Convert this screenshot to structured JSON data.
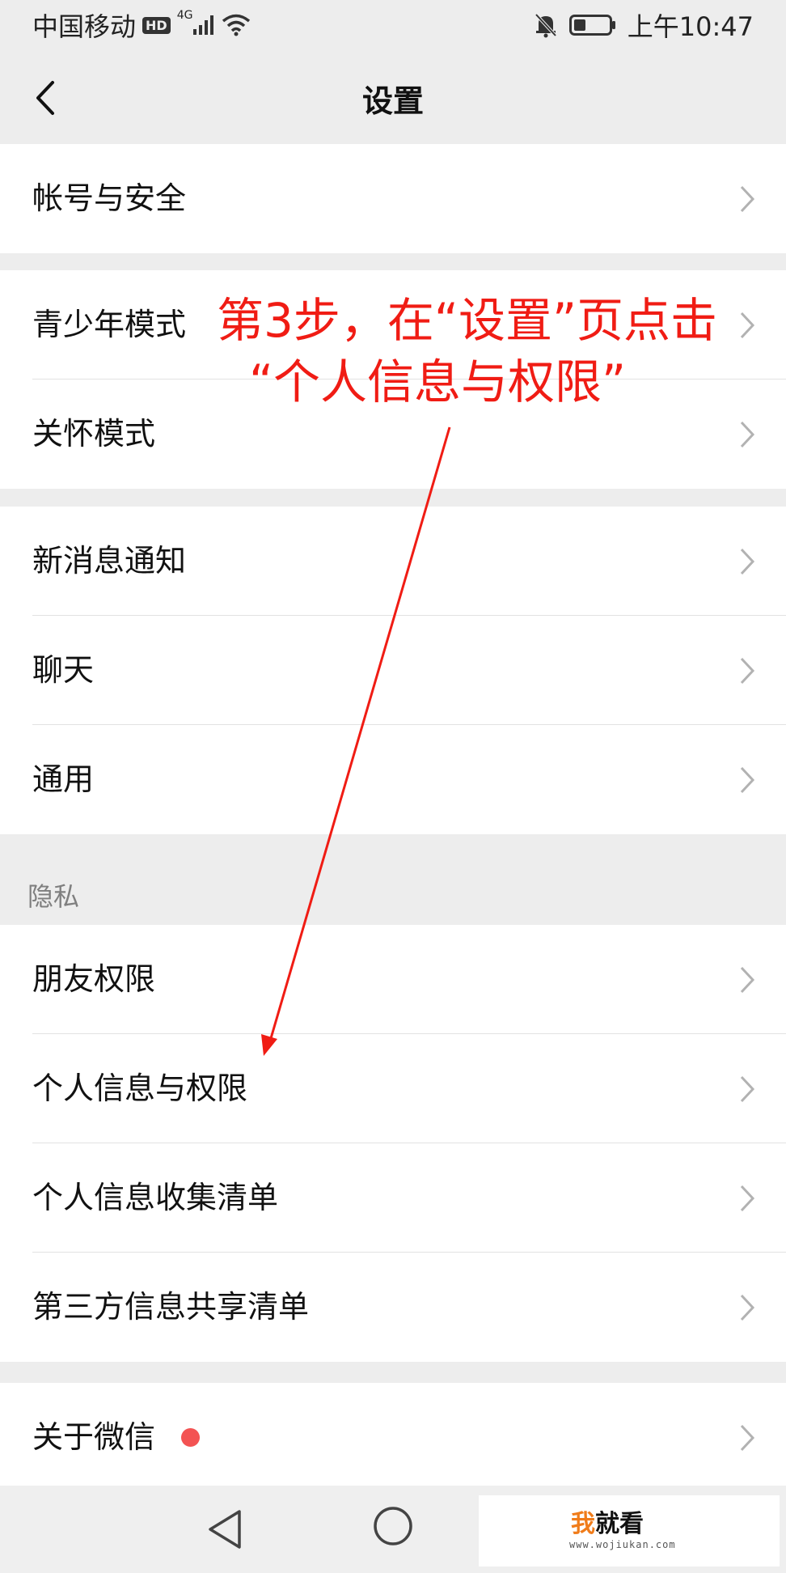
{
  "status_bar": {
    "carrier": "中国移动",
    "hd_badge": "HD",
    "network": "4G",
    "time": "上午10:47"
  },
  "nav": {
    "title": "设置"
  },
  "groups": [
    {
      "items": [
        {
          "label": "帐号与安全"
        }
      ]
    },
    {
      "items": [
        {
          "label": "青少年模式"
        },
        {
          "label": "关怀模式"
        }
      ]
    },
    {
      "items": [
        {
          "label": "新消息通知"
        },
        {
          "label": "聊天"
        },
        {
          "label": "通用"
        }
      ]
    },
    {
      "header": "隐私",
      "items": [
        {
          "label": "朋友权限"
        },
        {
          "label": "个人信息与权限"
        },
        {
          "label": "个人信息收集清单"
        },
        {
          "label": "第三方信息共享清单"
        }
      ]
    },
    {
      "items": [
        {
          "label": "关于微信",
          "has_badge": true
        }
      ]
    }
  ],
  "annotation": {
    "line1": "第3步，在“设置”页点击",
    "line2": "“个人信息与权限”",
    "color": "#f01c14"
  },
  "watermark": {
    "brand_highlight": "我",
    "brand_rest": "就看",
    "url": "www.wojiukan.com"
  }
}
